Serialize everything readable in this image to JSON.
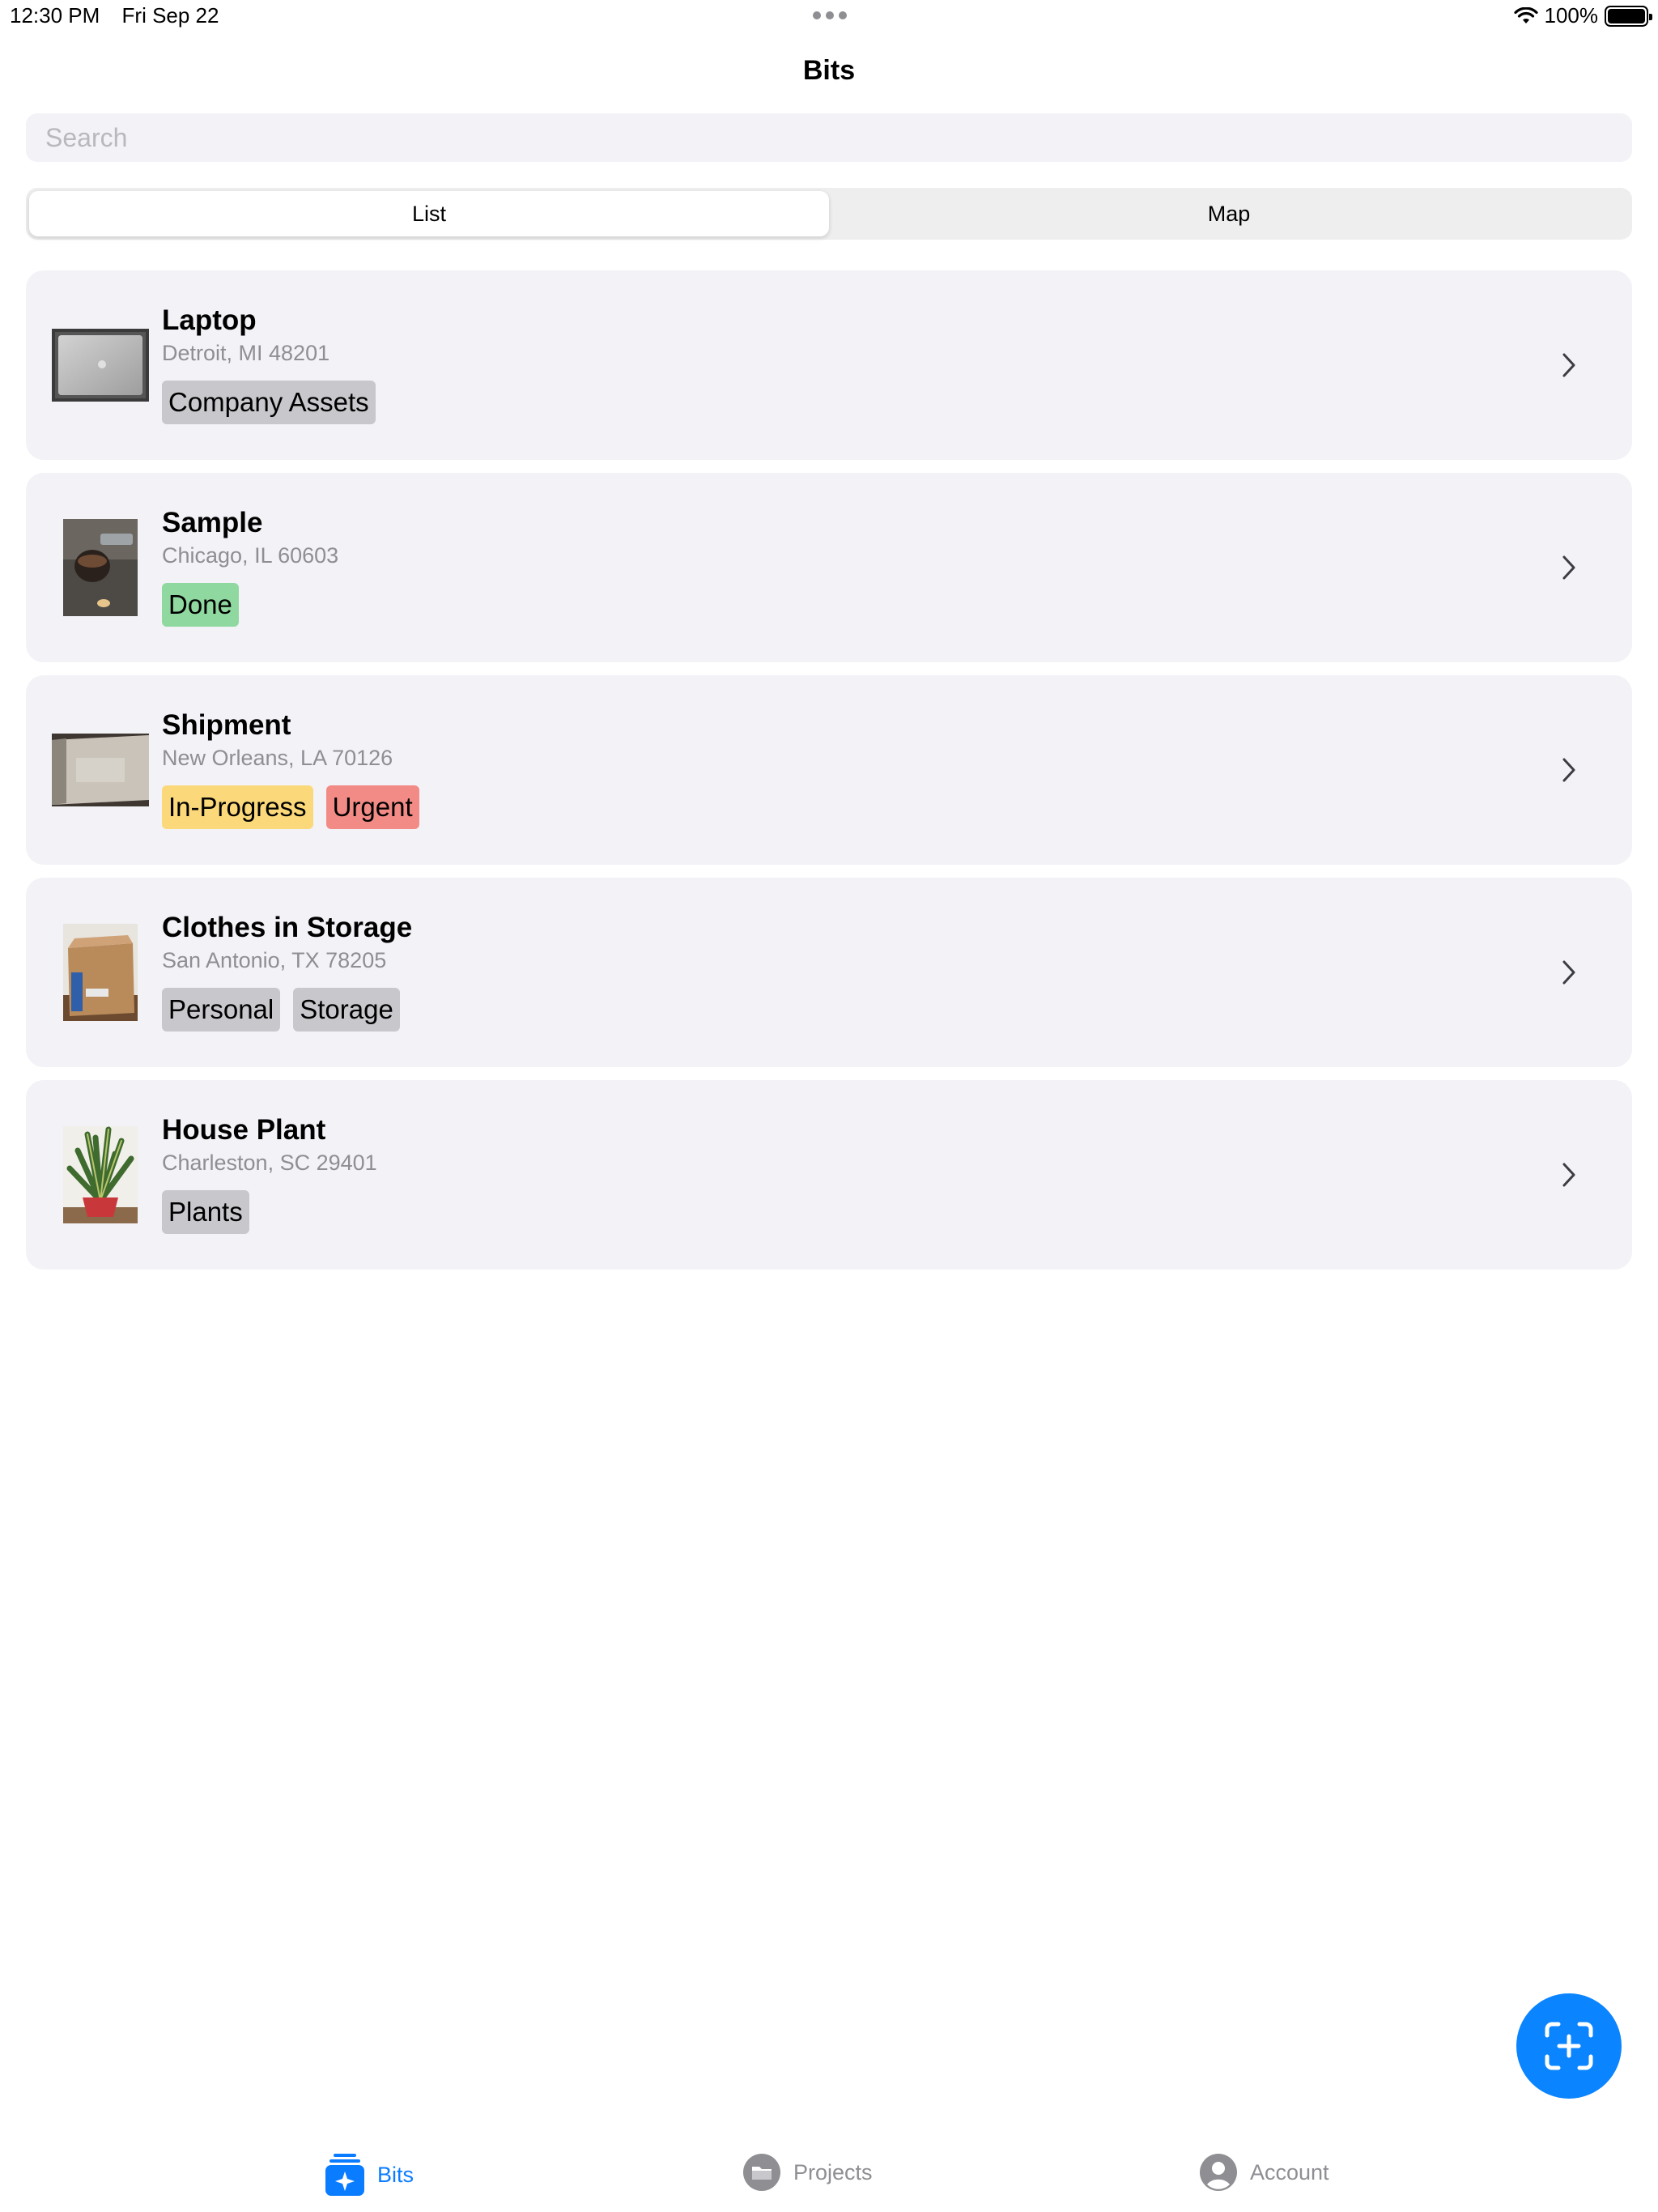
{
  "status_bar": {
    "time": "12:30 PM",
    "date": "Fri Sep 22",
    "battery": "100%"
  },
  "nav": {
    "title": "Bits"
  },
  "search": {
    "placeholder": "Search"
  },
  "segmented": {
    "options": [
      "List",
      "Map"
    ],
    "selected": "List"
  },
  "items": [
    {
      "title": "Laptop",
      "location": "Detroit, MI 48201",
      "tags": [
        {
          "label": "Company Assets",
          "color": "#c7c7cc"
        }
      ],
      "thumbnail": "laptop-photo"
    },
    {
      "title": "Sample",
      "location": "Chicago, IL 60603",
      "tags": [
        {
          "label": "Done",
          "color": "#8fd8a0"
        }
      ],
      "thumbnail": "mug-photo"
    },
    {
      "title": "Shipment",
      "location": "New Orleans, LA 70126",
      "tags": [
        {
          "label": "In-Progress",
          "color": "#fbd97a"
        },
        {
          "label": "Urgent",
          "color": "#f28b85"
        }
      ],
      "thumbnail": "package-photo"
    },
    {
      "title": "Clothes in Storage",
      "location": "San Antonio, TX 78205",
      "tags": [
        {
          "label": "Personal",
          "color": "#c7c7cc"
        },
        {
          "label": "Storage",
          "color": "#c7c7cc"
        }
      ],
      "thumbnail": "box-photo"
    },
    {
      "title": "House Plant",
      "location": "Charleston, SC 29401",
      "tags": [
        {
          "label": "Plants",
          "color": "#c7c7cc"
        }
      ],
      "thumbnail": "plant-photo"
    }
  ],
  "fab": {
    "icon": "scan-add-icon",
    "color": "#0a84ff"
  },
  "tabbar": {
    "tabs": [
      {
        "label": "Bits",
        "icon": "bits-sparkle-icon",
        "active": true
      },
      {
        "label": "Projects",
        "icon": "folder-icon",
        "active": false
      },
      {
        "label": "Account",
        "icon": "person-circle-icon",
        "active": false
      }
    ],
    "active_color": "#0a7cff",
    "inactive_color": "#8e8e93"
  }
}
